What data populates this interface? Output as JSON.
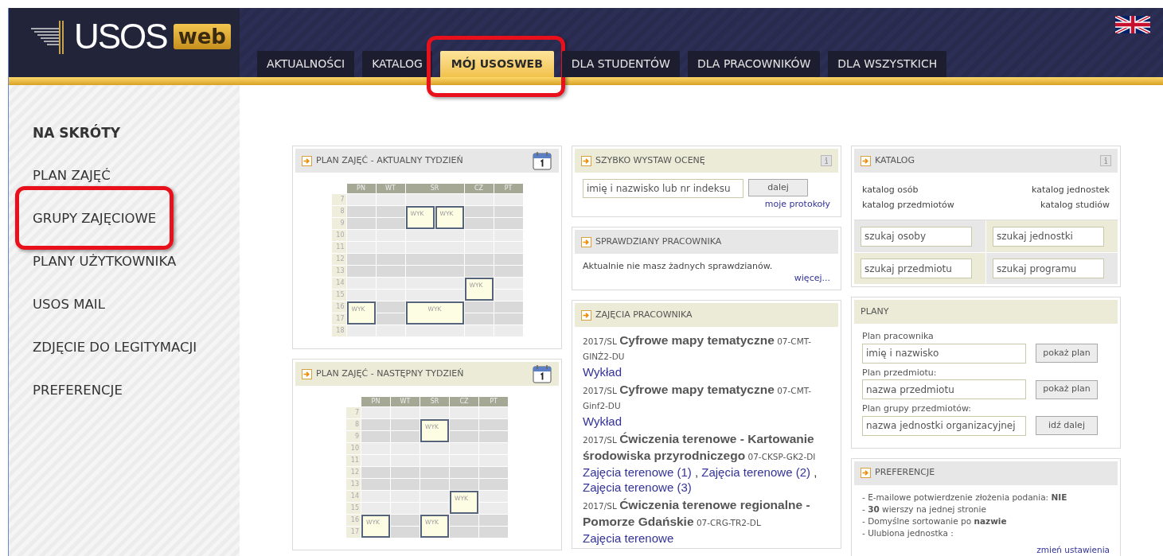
{
  "header": {
    "logo": {
      "text": "USOS",
      "badge": "web"
    },
    "tabs": [
      {
        "label": "AKTUALNOŚCI",
        "selected": false,
        "highlighted": false
      },
      {
        "label": "KATALOG",
        "selected": false,
        "highlighted": false
      },
      {
        "label": "MÓJ USOSWEB",
        "selected": true,
        "highlighted": true
      },
      {
        "label": "DLA STUDENTÓW",
        "selected": false,
        "highlighted": false
      },
      {
        "label": "DLA PRACOWNIKÓW",
        "selected": false,
        "highlighted": false
      },
      {
        "label": "DLA WSZYSTKICH",
        "selected": false,
        "highlighted": false
      }
    ]
  },
  "sidebar": {
    "heading": "NA SKRÓTY",
    "items": [
      {
        "label": "PLAN ZAJĘĆ",
        "highlighted": false
      },
      {
        "label": "GRUPY ZAJĘCIOWE",
        "highlighted": true
      },
      {
        "label": "PLANY UŻYTKOWNIKA",
        "highlighted": false
      },
      {
        "label": "USOS MAIL",
        "highlighted": false
      },
      {
        "label": "ZDJĘCIE DO LEGITYMACJI",
        "highlighted": false
      },
      {
        "label": "PREFERENCJE",
        "highlighted": false
      }
    ]
  },
  "columns": [
    {
      "panels": [
        {
          "kind": "schedule",
          "title": "PLAN ZAJĘĆ - AKTUALNY TYDZIEŃ",
          "tinted": false,
          "arrow": true,
          "info": false,
          "hours": [
            "7",
            "8",
            "9",
            "10",
            "11",
            "12",
            "13",
            "14",
            "15",
            "16",
            "17",
            "18"
          ],
          "days": [
            {
              "label": "PN",
              "lanes": [
                [
                  {
                    "kind": "free"
                  },
                  {
                    "kind": "free"
                  },
                  {
                    "kind": "free"
                  },
                  {
                    "kind": "free"
                  },
                  {
                    "kind": "free"
                  },
                  {
                    "kind": "free"
                  },
                  {
                    "kind": "free"
                  },
                  {
                    "kind": "free"
                  },
                  {
                    "kind": "free"
                  },
                  {
                    "kind": "start",
                    "label": "WYK",
                    "wide": false
                  },
                  {
                    "kind": "more"
                  },
                  {
                    "kind": "free"
                  }
                ]
              ]
            },
            {
              "label": "WT",
              "lanes": [
                [
                  {
                    "kind": "free"
                  },
                  {
                    "kind": "free"
                  },
                  {
                    "kind": "free"
                  },
                  {
                    "kind": "free"
                  },
                  {
                    "kind": "free"
                  },
                  {
                    "kind": "free"
                  },
                  {
                    "kind": "free"
                  },
                  {
                    "kind": "free"
                  },
                  {
                    "kind": "free"
                  },
                  {
                    "kind": "free"
                  },
                  {
                    "kind": "free"
                  },
                  {
                    "kind": "free"
                  }
                ]
              ]
            },
            {
              "label": "ŚR",
              "lanes": [
                [
                  {
                    "kind": "free"
                  },
                  {
                    "kind": "start",
                    "label": "WYK",
                    "wide": false
                  },
                  {
                    "kind": "more"
                  },
                  {
                    "kind": "free"
                  },
                  {
                    "kind": "free"
                  },
                  {
                    "kind": "free"
                  },
                  {
                    "kind": "free"
                  },
                  {
                    "kind": "free"
                  },
                  {
                    "kind": "free"
                  },
                  {
                    "kind": "start",
                    "label": "WYK",
                    "wide": true
                  },
                  {
                    "kind": "more"
                  },
                  {
                    "kind": "free"
                  }
                ],
                [
                  {
                    "kind": "free"
                  },
                  {
                    "kind": "start",
                    "label": "WYK",
                    "wide": false
                  },
                  {
                    "kind": "more"
                  },
                  {
                    "kind": "free"
                  },
                  {
                    "kind": "free"
                  },
                  {
                    "kind": "free"
                  },
                  {
                    "kind": "free"
                  },
                  {
                    "kind": "free"
                  },
                  {
                    "kind": "free"
                  },
                  {
                    "kind": "under"
                  },
                  {
                    "kind": "under"
                  },
                  {
                    "kind": "free"
                  }
                ]
              ]
            },
            {
              "label": "CZ",
              "lanes": [
                [
                  {
                    "kind": "free"
                  },
                  {
                    "kind": "free"
                  },
                  {
                    "kind": "free"
                  },
                  {
                    "kind": "free"
                  },
                  {
                    "kind": "free"
                  },
                  {
                    "kind": "free"
                  },
                  {
                    "kind": "free"
                  },
                  {
                    "kind": "start",
                    "label": "WYK",
                    "wide": false
                  },
                  {
                    "kind": "more"
                  },
                  {
                    "kind": "free"
                  },
                  {
                    "kind": "free"
                  },
                  {
                    "kind": "free"
                  }
                ]
              ]
            },
            {
              "label": "PT",
              "lanes": [
                [
                  {
                    "kind": "free"
                  },
                  {
                    "kind": "free"
                  },
                  {
                    "kind": "free"
                  },
                  {
                    "kind": "free"
                  },
                  {
                    "kind": "free"
                  },
                  {
                    "kind": "free"
                  },
                  {
                    "kind": "free"
                  },
                  {
                    "kind": "free"
                  },
                  {
                    "kind": "free"
                  },
                  {
                    "kind": "free"
                  },
                  {
                    "kind": "free"
                  },
                  {
                    "kind": "free"
                  }
                ]
              ]
            }
          ]
        },
        {
          "kind": "schedule",
          "title": "PLAN ZAJĘĆ - NASTĘPNY TYDZIEŃ",
          "tinted": true,
          "arrow": true,
          "info": false,
          "hours": [
            "7",
            "8",
            "9",
            "10",
            "11",
            "12",
            "13",
            "14",
            "15",
            "16",
            "17"
          ],
          "days": [
            {
              "label": "PN",
              "lanes": [
                [
                  {
                    "kind": "free"
                  },
                  {
                    "kind": "free"
                  },
                  {
                    "kind": "free"
                  },
                  {
                    "kind": "free"
                  },
                  {
                    "kind": "free"
                  },
                  {
                    "kind": "free"
                  },
                  {
                    "kind": "free"
                  },
                  {
                    "kind": "free"
                  },
                  {
                    "kind": "free"
                  },
                  {
                    "kind": "start",
                    "label": "WYK",
                    "wide": false
                  },
                  {
                    "kind": "more"
                  }
                ]
              ]
            },
            {
              "label": "WT",
              "lanes": [
                [
                  {
                    "kind": "free"
                  },
                  {
                    "kind": "free"
                  },
                  {
                    "kind": "free"
                  },
                  {
                    "kind": "free"
                  },
                  {
                    "kind": "free"
                  },
                  {
                    "kind": "free"
                  },
                  {
                    "kind": "free"
                  },
                  {
                    "kind": "free"
                  },
                  {
                    "kind": "free"
                  },
                  {
                    "kind": "free"
                  },
                  {
                    "kind": "free"
                  }
                ]
              ]
            },
            {
              "label": "ŚR",
              "lanes": [
                [
                  {
                    "kind": "free"
                  },
                  {
                    "kind": "start",
                    "label": "WYK",
                    "wide": false
                  },
                  {
                    "kind": "more"
                  },
                  {
                    "kind": "free"
                  },
                  {
                    "kind": "free"
                  },
                  {
                    "kind": "free"
                  },
                  {
                    "kind": "free"
                  },
                  {
                    "kind": "free"
                  },
                  {
                    "kind": "free"
                  },
                  {
                    "kind": "start",
                    "label": "WYK",
                    "wide": false
                  },
                  {
                    "kind": "more"
                  }
                ]
              ]
            },
            {
              "label": "CZ",
              "lanes": [
                [
                  {
                    "kind": "free"
                  },
                  {
                    "kind": "free"
                  },
                  {
                    "kind": "free"
                  },
                  {
                    "kind": "free"
                  },
                  {
                    "kind": "free"
                  },
                  {
                    "kind": "free"
                  },
                  {
                    "kind": "free"
                  },
                  {
                    "kind": "start",
                    "label": "WYK",
                    "wide": false
                  },
                  {
                    "kind": "more"
                  },
                  {
                    "kind": "free"
                  },
                  {
                    "kind": "free"
                  }
                ]
              ]
            },
            {
              "label": "PT",
              "lanes": [
                [
                  {
                    "kind": "free"
                  },
                  {
                    "kind": "free"
                  },
                  {
                    "kind": "free"
                  },
                  {
                    "kind": "free"
                  },
                  {
                    "kind": "free"
                  },
                  {
                    "kind": "free"
                  },
                  {
                    "kind": "free"
                  },
                  {
                    "kind": "free"
                  },
                  {
                    "kind": "free"
                  },
                  {
                    "kind": "free"
                  },
                  {
                    "kind": "free"
                  }
                ]
              ]
            }
          ]
        }
      ]
    },
    {
      "panels": [
        {
          "kind": "grade",
          "title": "SZYBKO WYSTAW OCENĘ",
          "tinted": true,
          "arrow": true,
          "info": true,
          "placeholder": "imię i nazwisko lub nr indeksu",
          "button": "dalej",
          "link": "moje protokoły"
        },
        {
          "kind": "tests",
          "title": "SPRAWDZIANY PRACOWNIKA",
          "tinted": false,
          "arrow": true,
          "info": false,
          "text": "Aktualnie nie masz żadnych sprawdzianów.",
          "link": "więcej..."
        },
        {
          "kind": "courses",
          "title": "ZAJĘCIA PRACOWNIKA",
          "tinted": true,
          "arrow": true,
          "info": false,
          "courses": [
            {
              "heading": "2017/SL **Cyfrowe mapy tematyczne** 07-CMT-GINŻ2-DU",
              "links": [
                "Wykład"
              ]
            },
            {
              "heading": "2017/SL **Cyfrowe mapy tematyczne** 07-CMT-Ginf2-DU",
              "links": [
                "Wykład"
              ]
            },
            {
              "heading": "2017/SL **Ćwiczenia terenowe - Kartowanie środowiska przyrodniczego** 07-CKSP-GK2-DI",
              "links": [
                "Zajęcia terenowe (1)",
                "Zajęcia terenowe (2)",
                "Zajęcia terenowe (3)"
              ],
              "separator": ","
            },
            {
              "heading": "2017/SL **Ćwiczenia terenowe regionalne - Pomorze Gdańskie** 07-CRG-TR2-DL",
              "links": [
                "Zajęcia terenowe"
              ]
            }
          ]
        }
      ]
    },
    {
      "panels": [
        {
          "kind": "catalog",
          "title": "KATALOG",
          "tinted": false,
          "arrow": true,
          "info": true,
          "links": [
            "katalog osób",
            "katalog jednostek",
            "katalog przedmiotów",
            "katalog studiów"
          ],
          "fields": [
            {
              "placeholder": "szukaj osoby"
            },
            {
              "placeholder": "szukaj jednostki"
            },
            {
              "placeholder": "szukaj przedmiotu"
            },
            {
              "placeholder": "szukaj programu"
            }
          ]
        },
        {
          "kind": "plans",
          "title": "PLANY",
          "tinted": true,
          "arrow": false,
          "info": false,
          "rows": [
            {
              "label": "Plan pracownika",
              "placeholder": "imię i nazwisko",
              "button": "pokaż plan"
            },
            {
              "label": "Plan przedmiotu:",
              "placeholder": "nazwa przedmiotu",
              "button": "pokaż plan"
            },
            {
              "label": "Plan grupy przedmiotów:",
              "placeholder": "nazwa jednostki organizacyjnej",
              "button": "idź dalej"
            }
          ]
        },
        {
          "kind": "preferences",
          "title": "PREFERENCJE",
          "tinted": false,
          "arrow": true,
          "info": false,
          "items": [
            "- E-mailowe potwierdzenie złożenia podania: **NIE**",
            "- **30** wierszy na jednej stronie",
            "- Domyślne sortowanie po **nazwie**",
            "- Ulubiona jednostka :"
          ],
          "link": "zmień ustawienia"
        }
      ]
    }
  ]
}
